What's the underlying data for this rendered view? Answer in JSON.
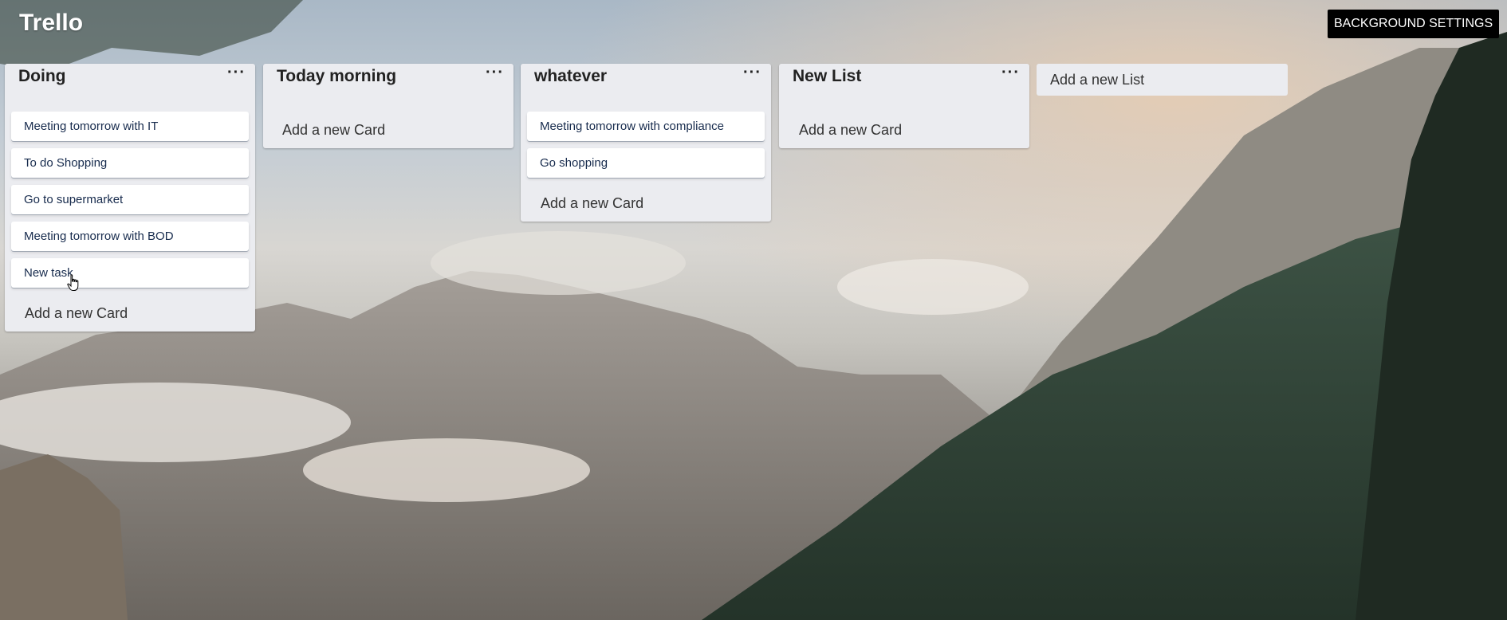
{
  "app": {
    "title": "Trello"
  },
  "header": {
    "background_settings_label": "BACKGROUND SETTINGS"
  },
  "lists": [
    {
      "title": "Doing",
      "menu": "···",
      "cards": [
        "Meeting tomorrow with IT",
        "To do Shopping",
        "Go to supermarket",
        "Meeting tomorrow with BOD",
        "New task"
      ],
      "add_card_label": "Add a new Card"
    },
    {
      "title": "Today morning",
      "menu": "···",
      "cards": [],
      "add_card_label": "Add a new Card"
    },
    {
      "title": "whatever",
      "menu": "···",
      "cards": [
        "Meeting tomorrow with compliance",
        "Go shopping"
      ],
      "add_card_label": "Add a new Card"
    },
    {
      "title": "New List",
      "menu": "···",
      "cards": [],
      "add_card_label": "Add a new Card"
    }
  ],
  "add_list_label": "Add a new List",
  "colors": {
    "list_bg": "#ebecf0",
    "card_bg": "#ffffff",
    "settings_button_bg": "#000000"
  },
  "icons": {
    "list_menu": "ellipsis-icon",
    "cursor": "hand-pointer-icon"
  }
}
